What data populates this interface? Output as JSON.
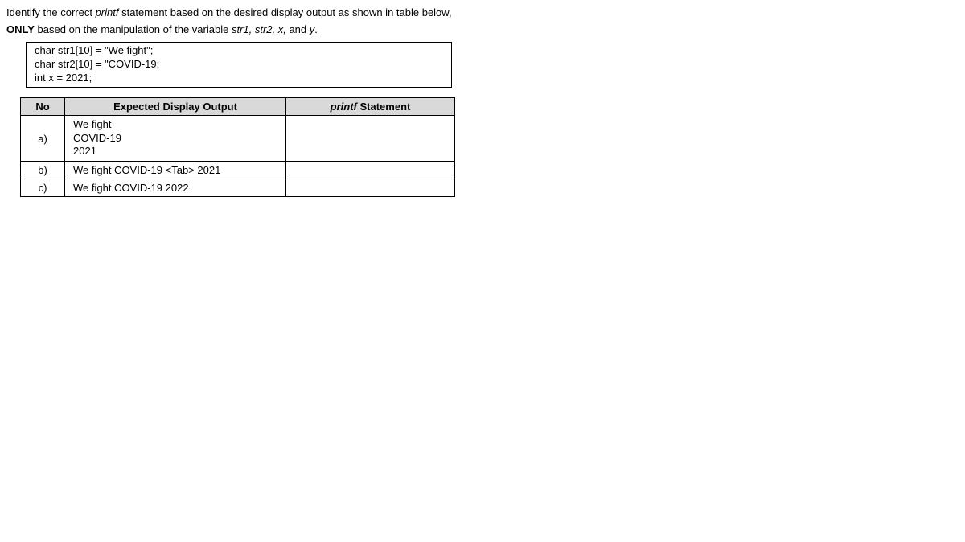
{
  "intro": {
    "part1_a": "Identify the correct ",
    "part1_b": "printf",
    "part1_c": " statement based on the desired display output as shown in table below,",
    "part2_a": "ONLY",
    "part2_b": " based on the manipulation of the variable ",
    "part2_c": "str1, str2, x,",
    "part2_d": " and ",
    "part2_e": "y",
    "part2_f": "."
  },
  "code": {
    "line1": "char str1[10] = \"We fight\";",
    "line2": "char str2[10] = \"COVID-19;",
    "line3": "int x = 2021;"
  },
  "table": {
    "headers": {
      "no": "No",
      "expected": "Expected Display Output",
      "printf_a": "printf",
      "printf_b": " Statement"
    },
    "rows": [
      {
        "no": "a)",
        "expected": "We fight\nCOVID-19\n2021",
        "printf": ""
      },
      {
        "no": "b)",
        "expected": "We fight COVID-19 <Tab> 2021",
        "printf": ""
      },
      {
        "no": "c)",
        "expected": "We fight COVID-19 2022",
        "printf": ""
      }
    ]
  }
}
